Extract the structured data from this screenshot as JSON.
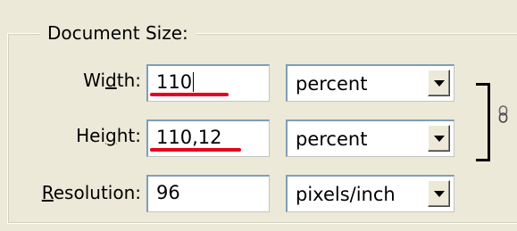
{
  "group": {
    "title": "Document Size:"
  },
  "width": {
    "label_pre": "Wi",
    "label_mnemonic": "d",
    "label_post": "th:",
    "value": "110",
    "unit": "percent"
  },
  "height": {
    "label_pre": "Hei",
    "label_mnemonic": "g",
    "label_post": "ht:",
    "value": "110,12",
    "unit": "percent"
  },
  "resolution": {
    "label_pre": "",
    "label_mnemonic": "R",
    "label_post": "esolution:",
    "value": "96",
    "unit": "pixels/inch"
  },
  "colors": {
    "annotation_underline": "#e8001c"
  },
  "icons": {
    "constrain_proportions": "chain-link-icon"
  }
}
